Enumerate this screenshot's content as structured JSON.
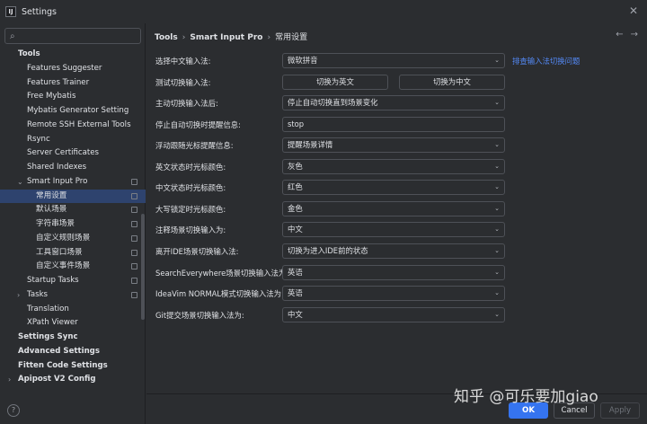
{
  "window": {
    "title": "Settings",
    "app_icon_text": "IJ"
  },
  "sidebar": {
    "search_placeholder": "",
    "items": [
      {
        "label": "Tools",
        "level": 0,
        "bold": true,
        "y": 0
      },
      {
        "label": "Features Suggester",
        "level": 1
      },
      {
        "label": "Features Trainer",
        "level": 1
      },
      {
        "label": "Free Mybatis",
        "level": 1
      },
      {
        "label": "Mybatis Generator Setting",
        "level": 1
      },
      {
        "label": "Remote SSH External Tools",
        "level": 1
      },
      {
        "label": "Rsync",
        "level": 1
      },
      {
        "label": "Server Certificates",
        "level": 1
      },
      {
        "label": "Shared Indexes",
        "level": 1
      },
      {
        "label": "Smart Input Pro",
        "level": 1,
        "arrow": "down",
        "project": true
      },
      {
        "label": "常用设置",
        "level": 2,
        "selected": true,
        "project": true
      },
      {
        "label": "默认场景",
        "level": 2,
        "project": true
      },
      {
        "label": "字符串场景",
        "level": 2,
        "project": true
      },
      {
        "label": "自定义规则场景",
        "level": 2,
        "project": true
      },
      {
        "label": "工具窗口场景",
        "level": 2,
        "project": true
      },
      {
        "label": "自定义事件场景",
        "level": 2,
        "project": true
      },
      {
        "label": "Startup Tasks",
        "level": 1,
        "project": true
      },
      {
        "label": "Tasks",
        "level": 1,
        "arrow": "right",
        "project": true
      },
      {
        "label": "Translation",
        "level": 1
      },
      {
        "label": "XPath Viewer",
        "level": 1
      },
      {
        "label": "Settings Sync",
        "level": 0,
        "bold": true
      },
      {
        "label": "Advanced Settings",
        "level": 0,
        "bold": true
      },
      {
        "label": "Fitten Code Settings",
        "level": 0,
        "bold": true
      },
      {
        "label": "Apipost V2 Config",
        "level": 0,
        "bold": true,
        "arrow": "right"
      }
    ]
  },
  "breadcrumb": [
    "Tools",
    "Smart Input Pro",
    "常用设置"
  ],
  "form": {
    "rows": [
      {
        "label": "选择中文输入法:",
        "type": "select",
        "value": "微软拼音",
        "link": "排查输入法切换问题"
      },
      {
        "label": "测试切换输入法:",
        "type": "buttons",
        "buttons": [
          "切换为英文",
          "切换为中文"
        ]
      },
      {
        "label": "主动切换输入法后:",
        "type": "select",
        "value": "停止自动切换直到场景变化"
      },
      {
        "label": "停止自动切换时提醒信息:",
        "type": "text",
        "value": "stop"
      },
      {
        "label": "浮动跟随光标提醒信息:",
        "type": "select",
        "value": "提醒场景详情"
      },
      {
        "label": "英文状态时光标颜色:",
        "type": "select",
        "value": "灰色"
      },
      {
        "label": "中文状态时光标颜色:",
        "type": "select",
        "value": "红色"
      },
      {
        "label": "大写锁定时光标颜色:",
        "type": "select",
        "value": "金色"
      },
      {
        "label": "注释场景切换输入为:",
        "type": "select",
        "value": "中文"
      },
      {
        "label": "离开IDE场景切换输入法:",
        "type": "select",
        "value": "切换为进入IDE前的状态"
      },
      {
        "label": "SearchEverywhere场景切换输入法为:",
        "type": "select",
        "value": "英语"
      },
      {
        "label": "IdeaVim NORMAL模式切换输入法为:",
        "type": "select",
        "value": "英语"
      },
      {
        "label": "Git提交场景切换输入法为:",
        "type": "select",
        "value": "中文"
      }
    ]
  },
  "footer": {
    "ok": "OK",
    "cancel": "Cancel",
    "apply": "Apply",
    "help": "?"
  },
  "watermark": "知乎 @可乐要加giao"
}
